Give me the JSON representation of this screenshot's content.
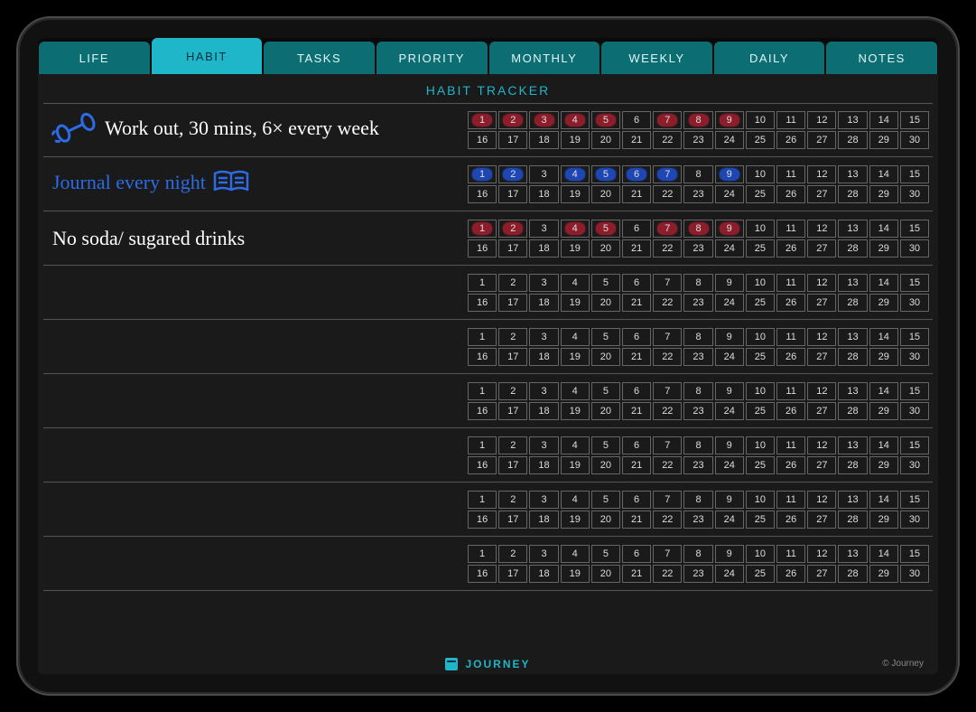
{
  "tabs": [
    {
      "label": "LIFE",
      "active": false
    },
    {
      "label": "HABIT",
      "active": true
    },
    {
      "label": "TASKS",
      "active": false
    },
    {
      "label": "PRIORITY",
      "active": false
    },
    {
      "label": "MONTHLY",
      "active": false
    },
    {
      "label": "WEEKLY",
      "active": false
    },
    {
      "label": "DAILY",
      "active": false
    },
    {
      "label": "NOTES",
      "active": false
    }
  ],
  "page_title": "HABIT TRACKER",
  "days_per_row": 30,
  "habits": [
    {
      "label": "Work out, 30 mins, 6× every week",
      "color": "white",
      "icon": "dumbbell-icon",
      "marks": {
        "1": "red",
        "2": "red",
        "3": "red",
        "4": "red",
        "5": "red",
        "7": "red",
        "8": "red",
        "9": "red"
      }
    },
    {
      "label": "Journal every night",
      "color": "blue",
      "icon": "book-icon",
      "marks": {
        "1": "blue",
        "2": "blue",
        "4": "blue",
        "5": "blue",
        "6": "blue",
        "7": "blue",
        "9": "blue"
      }
    },
    {
      "label": "No soda/ sugared drinks",
      "color": "white",
      "icon": null,
      "marks": {
        "1": "red",
        "2": "red",
        "4": "red",
        "5": "red",
        "7": "red",
        "8": "red",
        "9": "red"
      }
    },
    {
      "label": "",
      "color": "white",
      "icon": null,
      "marks": {}
    },
    {
      "label": "",
      "color": "white",
      "icon": null,
      "marks": {}
    },
    {
      "label": "",
      "color": "white",
      "icon": null,
      "marks": {}
    },
    {
      "label": "",
      "color": "white",
      "icon": null,
      "marks": {}
    },
    {
      "label": "",
      "color": "white",
      "icon": null,
      "marks": {}
    },
    {
      "label": "",
      "color": "white",
      "icon": null,
      "marks": {}
    }
  ],
  "footer": {
    "brand": "JOURNEY",
    "copyright": "© Journey"
  },
  "colors": {
    "tab_bg": "#0c6e72",
    "tab_active_bg": "#1fb6c9",
    "accent": "#1fb6c9",
    "mark_red": "#a01f2f",
    "mark_blue": "#1f4fd0",
    "page_bg": "#1a1a1a"
  }
}
